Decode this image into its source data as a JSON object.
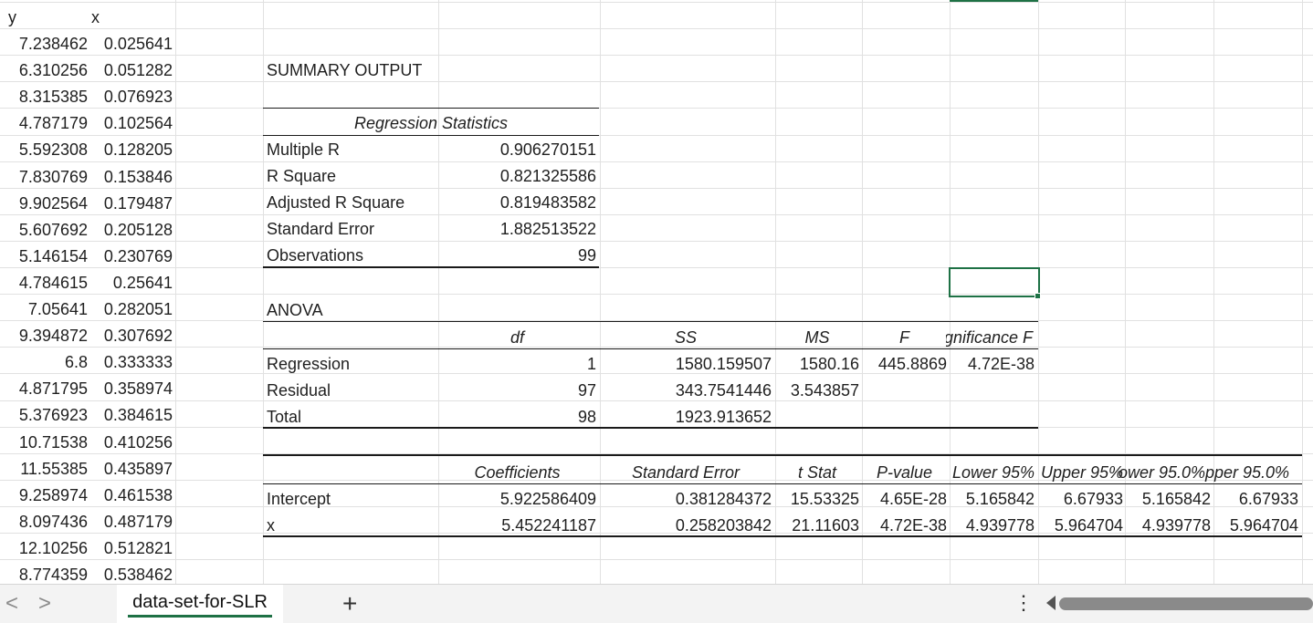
{
  "columns": {
    "y_header": "y",
    "x_header": "x",
    "rows": [
      [
        "7.238462",
        "0.025641"
      ],
      [
        "6.310256",
        "0.051282"
      ],
      [
        "8.315385",
        "0.076923"
      ],
      [
        "4.787179",
        "0.102564"
      ],
      [
        "5.592308",
        "0.128205"
      ],
      [
        "7.830769",
        "0.153846"
      ],
      [
        "9.902564",
        "0.179487"
      ],
      [
        "5.607692",
        "0.205128"
      ],
      [
        "5.146154",
        "0.230769"
      ],
      [
        "4.784615",
        "0.25641"
      ],
      [
        "7.05641",
        "0.282051"
      ],
      [
        "9.394872",
        "0.307692"
      ],
      [
        "6.8",
        "0.333333"
      ],
      [
        "4.871795",
        "0.358974"
      ],
      [
        "5.376923",
        "0.384615"
      ],
      [
        "10.71538",
        "0.410256"
      ],
      [
        "11.55385",
        "0.435897"
      ],
      [
        "9.258974",
        "0.461538"
      ],
      [
        "8.097436",
        "0.487179"
      ],
      [
        "12.10256",
        "0.512821"
      ],
      [
        "8.774359",
        "0.538462"
      ]
    ]
  },
  "summary": {
    "title": "SUMMARY OUTPUT",
    "regression_statistics": {
      "header": "Regression Statistics",
      "rows": [
        [
          "Multiple R",
          "0.906270151"
        ],
        [
          "R Square",
          "0.821325586"
        ],
        [
          "Adjusted R Square",
          "0.819483582"
        ],
        [
          "Standard Error",
          "1.882513522"
        ],
        [
          "Observations",
          "99"
        ]
      ]
    },
    "anova": {
      "title": "ANOVA",
      "headers": [
        "df",
        "SS",
        "MS",
        "F",
        "ignificance F"
      ],
      "rows": [
        [
          "Regression",
          "1",
          "1580.159507",
          "1580.16",
          "445.8869",
          "4.72E-38"
        ],
        [
          "Residual",
          "97",
          "343.7541446",
          "3.543857",
          "",
          ""
        ],
        [
          "Total",
          "98",
          "1923.913652",
          "",
          "",
          ""
        ]
      ]
    },
    "coefficients": {
      "headers": [
        "Coefficients",
        "Standard Error",
        "t Stat",
        "P-value",
        "Lower 95%",
        "Upper 95%",
        "ower 95.0%",
        "pper 95.0%"
      ],
      "rows": [
        [
          "Intercept",
          "5.922586409",
          "0.381284372",
          "15.53325",
          "4.65E-28",
          "5.165842",
          "6.67933",
          "5.165842",
          "6.67933"
        ],
        [
          "x",
          "5.452241187",
          "0.258203842",
          "21.11603",
          "4.72E-38",
          "4.939778",
          "5.964704",
          "4.939778",
          "5.964704"
        ]
      ]
    }
  },
  "sheet_tabs": {
    "active": "data-set-for-SLR",
    "add_label": "+",
    "more_label": "⋮",
    "prev_label": "<",
    "next_label": ">"
  },
  "colors": {
    "accent": "#1e7145",
    "grid": "#e1e1e1"
  }
}
